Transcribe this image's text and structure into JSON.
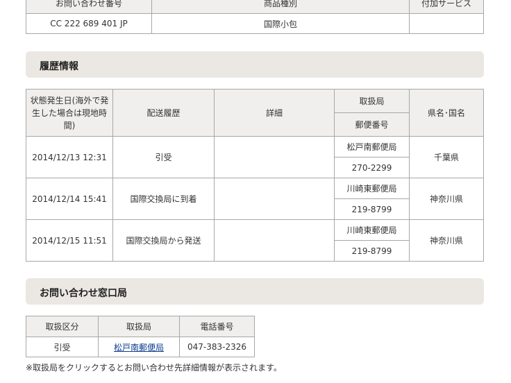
{
  "item_info": {
    "headers": [
      "お問い合わせ番号",
      "商品種別",
      "付加サービス"
    ],
    "row": {
      "tracking_number": "CC 222 689 401 JP",
      "item_type": "国際小包",
      "additional_service": ""
    }
  },
  "history": {
    "title": "履歴情報",
    "headers": {
      "date": "状態発生日(海外で発生した場合は現地時間)",
      "event": "配送履歴",
      "detail": "詳細",
      "office": "取扱局",
      "postcode": "郵便番号",
      "region": "県名･国名"
    },
    "rows": [
      {
        "date": "2014/12/13 12:31",
        "event": "引受",
        "detail": "",
        "office": "松戸南郵便局",
        "postcode": "270-2299",
        "region": "千葉県"
      },
      {
        "date": "2014/12/14 15:41",
        "event": "国際交換局に到着",
        "detail": "",
        "office": "川崎東郵便局",
        "postcode": "219-8799",
        "region": "神奈川県"
      },
      {
        "date": "2014/12/15 11:51",
        "event": "国際交換局から発送",
        "detail": "",
        "office": "川崎東郵便局",
        "postcode": "219-8799",
        "region": "神奈川県"
      }
    ]
  },
  "contact": {
    "title": "お問い合わせ窓口局",
    "headers": [
      "取扱区分",
      "取扱局",
      "電話番号"
    ],
    "row": {
      "category": "引受",
      "office": "松戸南郵便局",
      "phone": "047-383-2326"
    },
    "note": "※取扱局をクリックするとお問い合わせ先詳細情報が表示されます。"
  },
  "colors": {
    "section_bg": "#ebe8e3",
    "header_bg": "#f0efed",
    "border": "#a7a7a7",
    "link": "#0b3c8c"
  }
}
